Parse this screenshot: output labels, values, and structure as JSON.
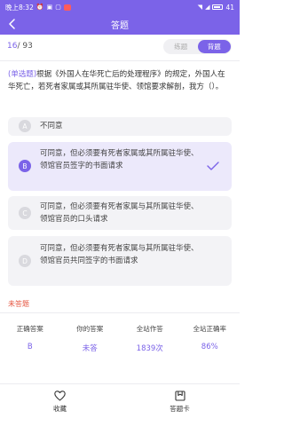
{
  "statusbar": {
    "time": "晚上8:32",
    "battery": "41"
  },
  "header": {
    "title": "答题"
  },
  "progress": {
    "current": "16",
    "total": "/ 93"
  },
  "mode_tabs": [
    {
      "label": "练题",
      "active": false
    },
    {
      "label": "背题",
      "active": true
    }
  ],
  "question": {
    "type_label": "(单选题)",
    "text": "根据《外国人在华死亡后的处理程序》的规定，外国人在华死亡，若死者家属或其所属驻华使、领馆要求解剖，我方（）。"
  },
  "options": [
    {
      "letter": "A",
      "text": "不同意",
      "selected": false
    },
    {
      "letter": "B",
      "text": "可同意，但必须要有死者家属或其所属驻华使、领馆官员签字的书面请求",
      "selected": true
    },
    {
      "letter": "C",
      "text": "可同意，但必须要有死者家属与其所属驻华使、领馆官员的口头请求",
      "selected": false
    },
    {
      "letter": "D",
      "text": "可同意，但必须要有死者家属与其所属驻华使、领馆官员共同签字的书面请求",
      "selected": false
    }
  ],
  "status": {
    "unanswered_label": "未答题"
  },
  "stats": {
    "labels": [
      "正确答案",
      "你的答案",
      "全站作答",
      "全站正确率"
    ],
    "values": [
      "B",
      "未答",
      "1839次",
      "86%"
    ]
  },
  "tabbar": [
    {
      "label": "收藏",
      "icon": "heart-icon"
    },
    {
      "label": "答题卡",
      "icon": "answer-card-icon"
    }
  ],
  "colors": {
    "accent": "#7b63e8",
    "warning": "#e5533e"
  }
}
